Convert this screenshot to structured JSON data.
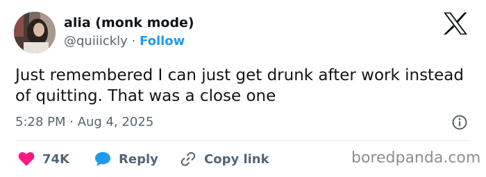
{
  "author": {
    "display_name": "alia (monk mode)",
    "handle": "@quiiickly",
    "separator": "·",
    "follow_label": "Follow"
  },
  "tweet": {
    "text": "Just remembered I can just get drunk after work instead of quitting. That was a close one",
    "timestamp": "5:28 PM · Aug 4, 2025"
  },
  "actions": {
    "like_count": "74K",
    "reply_label": "Reply",
    "copy_link_label": "Copy link"
  },
  "watermark": "boredpanda.com",
  "icons": {
    "logo": "x-logo-icon",
    "info": "info-icon",
    "like": "heart-icon",
    "reply": "speech-bubble-icon",
    "copy": "link-icon"
  },
  "colors": {
    "like": "#f91880",
    "reply": "#1d9bf0",
    "follow": "#1d9bf0",
    "muted": "#536471"
  }
}
